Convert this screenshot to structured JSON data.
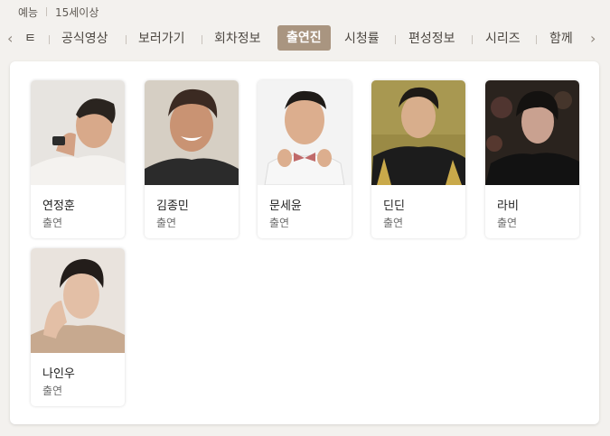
{
  "program": {
    "genre": "예능",
    "rating": "15세이상"
  },
  "nav": {
    "prev_icon": "chevron-left-icon",
    "next_icon": "chevron-right-icon",
    "tabs": [
      {
        "label": "ㅌ",
        "active": false
      },
      {
        "label": "공식영상",
        "active": false
      },
      {
        "label": "보러가기",
        "active": false
      },
      {
        "label": "회차정보",
        "active": false
      },
      {
        "label": "출연진",
        "active": true
      },
      {
        "label": "시청률",
        "active": false
      },
      {
        "label": "편성정보",
        "active": false
      },
      {
        "label": "시리즈",
        "active": false
      },
      {
        "label": "함께",
        "active": false
      }
    ]
  },
  "cast": [
    {
      "name": "연정훈",
      "role": "출연"
    },
    {
      "name": "김종민",
      "role": "출연"
    },
    {
      "name": "문세윤",
      "role": "출연"
    },
    {
      "name": "딘딘",
      "role": "출연"
    },
    {
      "name": "라비",
      "role": "출연"
    },
    {
      "name": "나인우",
      "role": "출연"
    }
  ],
  "colors": {
    "page_bg": "#f3f1ee",
    "active_tab_bg": "#a99580",
    "active_tab_text": "#ffffff"
  }
}
